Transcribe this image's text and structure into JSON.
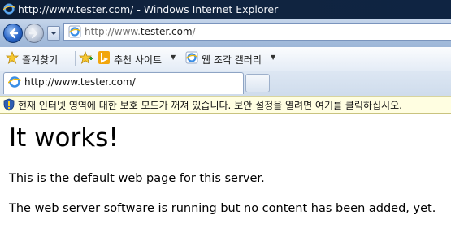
{
  "window": {
    "title": "http://www.tester.com/ - Windows Internet Explorer",
    "app_icon": "ie-icon"
  },
  "navigation": {
    "back_icon": "back-arrow-icon",
    "forward_icon": "forward-arrow-icon",
    "url_prefix": "http://www.",
    "url_domain": "tester.com",
    "url_suffix": "/"
  },
  "favorites_bar": {
    "favorites_label": "즐겨찾기",
    "suggested_sites_label": "추천 사이트",
    "web_slice_gallery_label": "웹 조각 갤러리"
  },
  "tabs": [
    {
      "label": "http://www.tester.com/",
      "active": true
    }
  ],
  "info_bar": {
    "text": "현재 인터넷 영역에 대한 보호 모드가 꺼져 있습니다. 보안 설정을 열려면 여기를 클릭하십시오."
  },
  "page": {
    "heading": "It works!",
    "paragraphs": [
      "This is the default web page for this server.",
      "The web server software is running but no content has been added, yet."
    ]
  },
  "colors": {
    "titlebar": "#0d1d36",
    "navbar": "#a9c0de",
    "infobar": "#fffee1"
  }
}
